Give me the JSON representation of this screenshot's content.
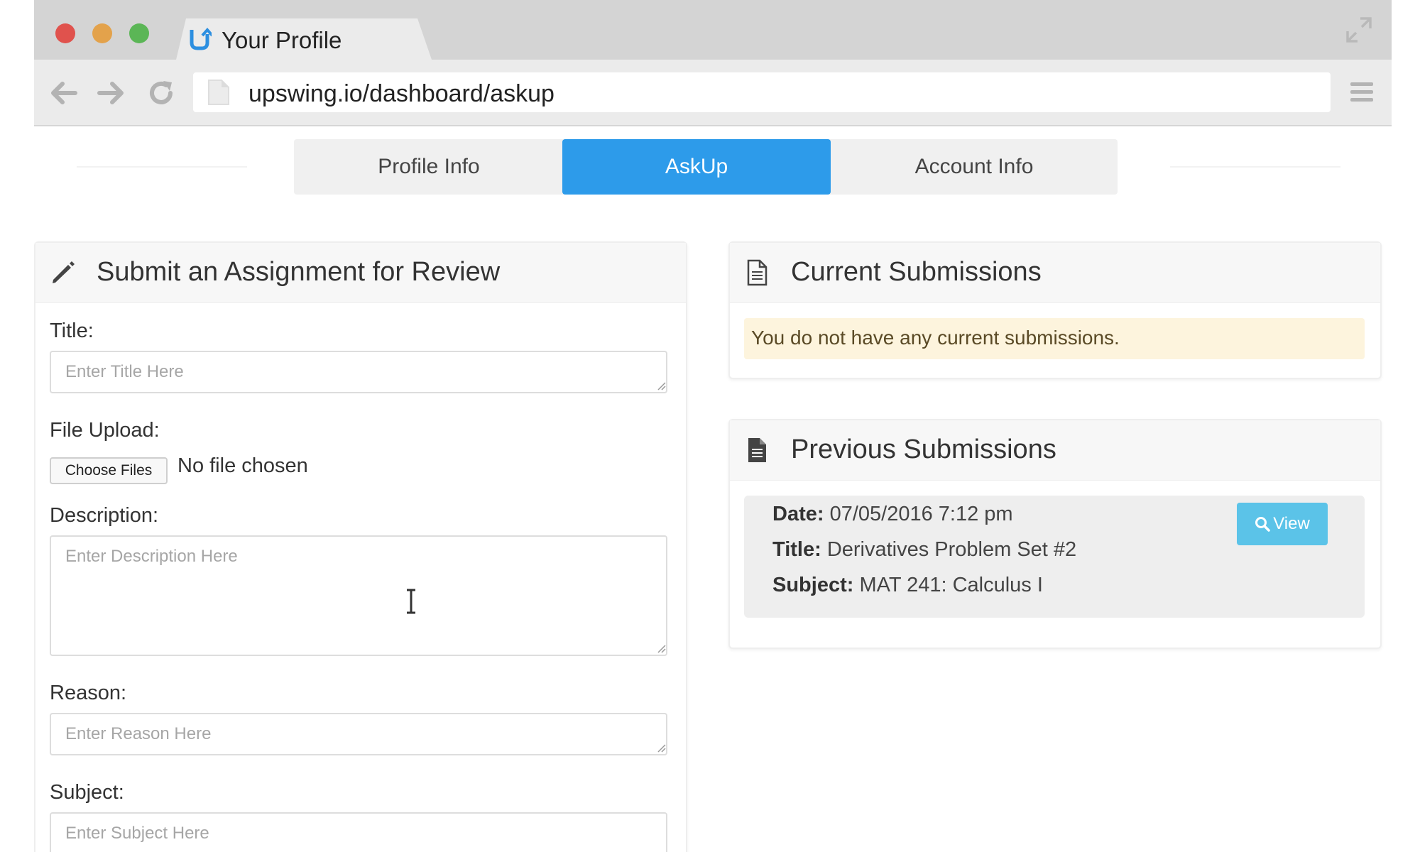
{
  "browser": {
    "tab_title": "Your Profile",
    "url": "upswing.io/dashboard/askup"
  },
  "nav_tabs": [
    {
      "label": "Profile Info",
      "active": false
    },
    {
      "label": "AskUp",
      "active": true
    },
    {
      "label": "Account Info",
      "active": false
    }
  ],
  "colors": {
    "accent": "#2d9bea",
    "view_button": "#5bc3e8",
    "alert_bg": "#fdf4dd",
    "traffic_red": "#e0524d",
    "traffic_yellow": "#e3a24b",
    "traffic_green": "#5bb656"
  },
  "submit_form": {
    "heading": "Submit an Assignment for Review",
    "icon": "pencil-icon",
    "title_label": "Title:",
    "title_placeholder": "Enter Title Here",
    "file_label": "File Upload:",
    "file_button": "Choose Files",
    "file_status": "No file chosen",
    "description_label": "Description:",
    "description_placeholder": "Enter Description Here",
    "reason_label": "Reason:",
    "reason_placeholder": "Enter Reason Here",
    "subject_label": "Subject:",
    "subject_placeholder": "Enter Subject Here"
  },
  "current_submissions": {
    "heading": "Current Submissions",
    "icon": "document-outline-icon",
    "empty_message": "You do not have any current submissions."
  },
  "previous_submissions": {
    "heading": "Previous Submissions",
    "icon": "document-filled-icon",
    "items": [
      {
        "date_label": "Date:",
        "date": "07/05/2016 7:12 pm",
        "title_label": "Title:",
        "title": "Derivatives Problem Set #2",
        "subject_label": "Subject:",
        "subject": "MAT 241: Calculus I",
        "view_label": "View"
      }
    ]
  }
}
